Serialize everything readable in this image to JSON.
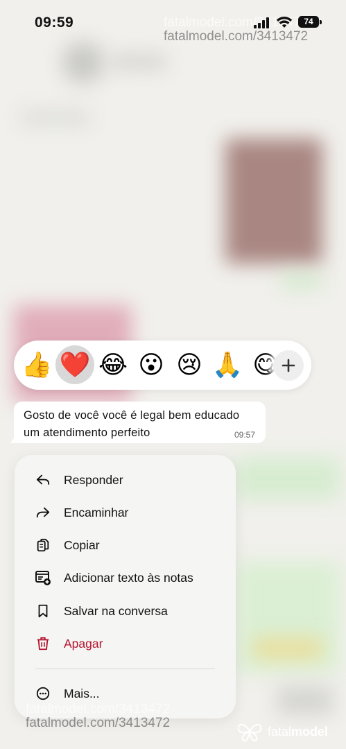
{
  "status_bar": {
    "time": "09:59",
    "battery": "74"
  },
  "watermark": {
    "url": "fatalmodel.com/3413472",
    "brand_light": "fatal",
    "brand_bold": "model"
  },
  "reactions": [
    {
      "emoji": "👍",
      "name": "thumbs-up"
    },
    {
      "emoji": "❤️",
      "name": "heart",
      "selected": true
    },
    {
      "emoji": "😂",
      "name": "tears-of-joy"
    },
    {
      "emoji": "😮",
      "name": "surprised"
    },
    {
      "emoji": "😢",
      "name": "crying"
    },
    {
      "emoji": "🙏",
      "name": "folded-hands"
    },
    {
      "emoji": "😋",
      "name": "yum"
    }
  ],
  "message": {
    "text": "Gosto de você você é legal bem educado um atendimento perfeito",
    "time": "09:57"
  },
  "menu": {
    "reply": "Responder",
    "forward": "Encaminhar",
    "copy": "Copiar",
    "add_to_notes": "Adicionar texto às notas",
    "save": "Salvar na conversa",
    "delete": "Apagar",
    "more": "Mais...",
    "danger_color": "#b4132f"
  }
}
